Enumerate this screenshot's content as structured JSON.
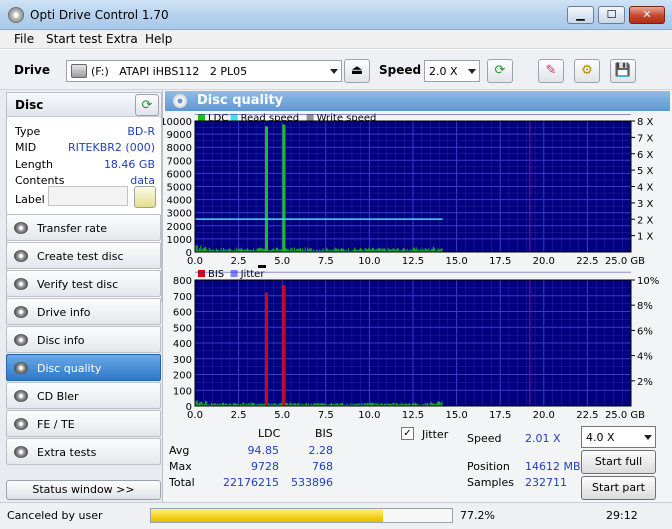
{
  "window": {
    "title": "Opti Drive Control 1.70"
  },
  "menu": [
    "File",
    "Start test",
    "Extra",
    "Help"
  ],
  "toolbar": {
    "drive_label": "Drive",
    "drive_value": "(F:)   ATAPI iHBS112   2 PL05",
    "speed_label": "Speed",
    "speed_value": "2.0 X"
  },
  "disc": {
    "header": "Disc",
    "props": [
      {
        "label": "Type",
        "value": "BD-R"
      },
      {
        "label": "MID",
        "value": "RITEKBR2 (000)"
      },
      {
        "label": "Length",
        "value": "18.46 GB"
      },
      {
        "label": "Contents",
        "value": "data"
      },
      {
        "label": "Label",
        "value": ""
      }
    ]
  },
  "nav": [
    {
      "label": "Transfer rate",
      "active": false
    },
    {
      "label": "Create test disc",
      "active": false
    },
    {
      "label": "Verify test disc",
      "active": false
    },
    {
      "label": "Drive info",
      "active": false
    },
    {
      "label": "Disc info",
      "active": false
    },
    {
      "label": "Disc quality",
      "active": true
    },
    {
      "label": "CD Bler",
      "active": false
    },
    {
      "label": "FE / TE",
      "active": false
    },
    {
      "label": "Extra tests",
      "active": false
    }
  ],
  "status_window_label": "Status window >>",
  "panel_title": "Disc quality",
  "chart_data": [
    {
      "type": "line",
      "legend": [
        "LDC",
        "Read speed",
        "Write speed"
      ],
      "colors": {
        "LDC": "#18c018",
        "Read speed": "#40e0f0",
        "Write speed": "#909090",
        "bg": "#000080",
        "grid": "#2a2aa0"
      },
      "x_ticks": [
        "0.0",
        "2.5",
        "5.0",
        "7.5",
        "10.0",
        "12.5",
        "15.0",
        "17.5",
        "20.0",
        "22.5",
        "25.0 GB"
      ],
      "xlim": [
        0,
        25
      ],
      "y_ticks": [
        "1000",
        "2000",
        "3000",
        "4000",
        "5000",
        "6000",
        "7000",
        "8000",
        "9000",
        "10000"
      ],
      "ylim": [
        0,
        10000
      ],
      "y2_ticks": [
        "1 X",
        "2 X",
        "3 X",
        "4 X",
        "5 X",
        "6 X",
        "7 X",
        "8 X"
      ],
      "y2lim": [
        0,
        8
      ],
      "spikes": [
        {
          "x": 4.1,
          "y": 9600
        },
        {
          "x": 5.1,
          "y": 9728
        }
      ],
      "read_speed": {
        "x": [
          0,
          14.2
        ],
        "y": 2.01
      },
      "noise_end": 14.2,
      "noise_level": 300
    },
    {
      "type": "line",
      "legend": [
        "BIS",
        "Jitter"
      ],
      "colors": {
        "BIS": "#e00000",
        "Jitter": "#8080ff",
        "bg": "#000080",
        "grid": "#2a2aa0"
      },
      "x_ticks": [
        "0.0",
        "2.5",
        "5.0",
        "7.5",
        "10.0",
        "12.5",
        "15.0",
        "17.5",
        "20.0",
        "22.5",
        "25.0 GB"
      ],
      "xlim": [
        0,
        25
      ],
      "y_ticks": [
        "100",
        "200",
        "300",
        "400",
        "500",
        "600",
        "700",
        "800"
      ],
      "ylim": [
        0,
        800
      ],
      "y2_ticks": [
        "2%",
        "4%",
        "6%",
        "8%",
        "10%"
      ],
      "y2lim": [
        0,
        10
      ],
      "spikes": [
        {
          "x": 4.1,
          "y": 720
        },
        {
          "x": 5.1,
          "y": 768
        }
      ],
      "noise_end": 14.2,
      "noise_level": 20
    }
  ],
  "stats": {
    "col_ldc": "LDC",
    "col_bis": "BIS",
    "rows": [
      {
        "label": "Avg",
        "ldc": "94.85",
        "bis": "2.28"
      },
      {
        "label": "Max",
        "ldc": "9728",
        "bis": "768"
      },
      {
        "label": "Total",
        "ldc": "22176215",
        "bis": "533896"
      }
    ],
    "jitter_label": "Jitter",
    "jitter_checked": "✓",
    "speed_label": "Speed",
    "speed_value": "2.01 X",
    "position_label": "Position",
    "position_value": "14612 MB",
    "samples_label": "Samples",
    "samples_value": "232711",
    "speed_select": "4.0 X",
    "start_full": "Start full",
    "start_part": "Start part"
  },
  "status": {
    "message": "Canceled by user",
    "progress_pct": 77.2,
    "progress_text": "77.2%",
    "time": "29:12"
  }
}
